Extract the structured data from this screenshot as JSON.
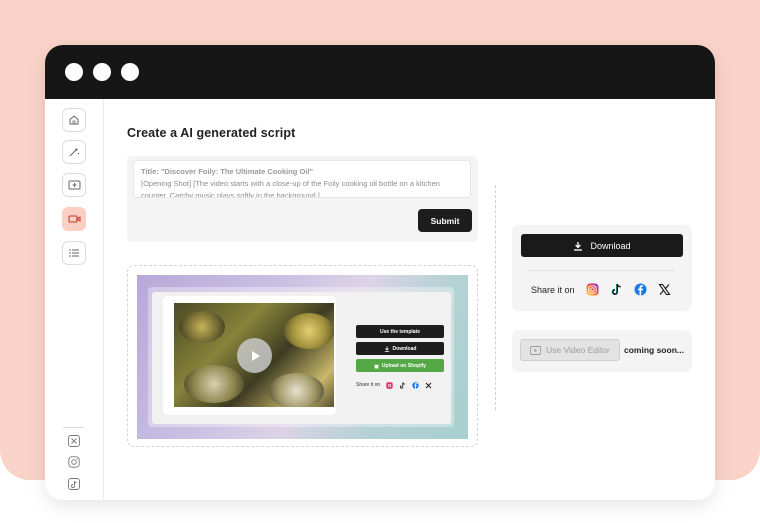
{
  "window": {
    "controls": [
      "close",
      "minimize",
      "maximize"
    ]
  },
  "sidebar": {
    "items": [
      {
        "icon": "home-icon",
        "active": false
      },
      {
        "icon": "magic-wand-icon",
        "active": false
      },
      {
        "icon": "add-media-icon",
        "active": false
      },
      {
        "icon": "video-camera-icon",
        "active": true
      },
      {
        "icon": "list-icon",
        "active": false
      }
    ],
    "social": [
      "x-icon",
      "instagram-icon",
      "tiktok-icon"
    ]
  },
  "main": {
    "heading": "Create a AI generated script",
    "prompt": {
      "title": "Title: \"Discover Foily: The Ultimate Cooking Oil\"",
      "body": "[Opening Shot] [The video starts with a close-up of the Foily cooking oil bottle on a kitchen counter. Catchy music plays softly in the background.]",
      "submit_label": "Submit"
    },
    "preview": {
      "use_template_label": "Use the template",
      "download_label": "Download",
      "upload_label": "Upload on Shopify",
      "share_label": "Share it on",
      "share_icons": [
        "instagram-icon",
        "tiktok-icon",
        "facebook-icon",
        "x-icon"
      ]
    }
  },
  "right_panel": {
    "download_label": "Download",
    "share_label": "Share it on",
    "share_icons": [
      "instagram-icon",
      "tiktok-icon",
      "facebook-icon",
      "x-icon"
    ],
    "editor_label": "Use Video Editor",
    "coming_soon": "coming soon..."
  },
  "colors": {
    "background": "#f9d3c7",
    "titlebar": "#161616",
    "active_item": "#fbcfc3",
    "primary_button": "#1d1d1d",
    "shopify_green": "#55a846"
  }
}
